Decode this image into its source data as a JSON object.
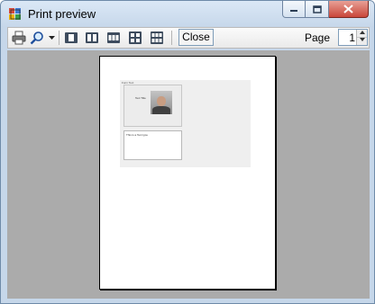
{
  "window": {
    "title": "Print preview"
  },
  "toolbar": {
    "print_icon": "printer-icon",
    "zoom_icon": "magnifier-icon",
    "zoom_dropdown_icon": "chevron-down-icon",
    "page_layouts": [
      {
        "icon": "one-page-icon"
      },
      {
        "icon": "two-pages-icon"
      },
      {
        "icon": "three-pages-icon"
      },
      {
        "icon": "four-pages-icon"
      },
      {
        "icon": "six-pages-icon"
      }
    ],
    "close_label": "Close",
    "page_label": "Page",
    "page_value": "1"
  },
  "preview": {
    "panel_caption": "Form Text",
    "label_text": "Text Title",
    "textbox_text": "This is a Text type"
  },
  "colors": {
    "titlebar": "#c6d7ea",
    "client_background": "#ababab",
    "close_button": "#c9473a"
  }
}
